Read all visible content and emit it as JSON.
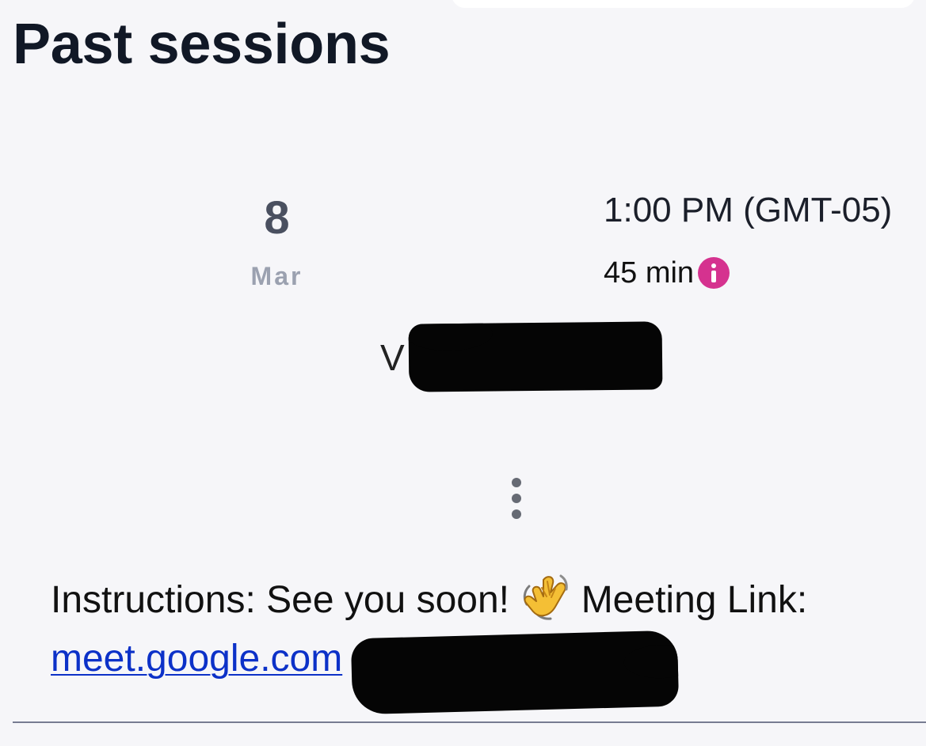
{
  "header": {
    "title": "Past sessions"
  },
  "session": {
    "date_day": "8",
    "date_month": "Mar",
    "time": "1:00 PM (GMT-05)",
    "duration": "45 min",
    "info_icon": "info-icon",
    "info_icon_color": "#d5328f",
    "attendee_name_visible": "V",
    "menu_icon": "vertical-ellipsis-icon",
    "instructions_prefix": "Instructions: See you soon!",
    "wave_icon": "waving-hand-icon",
    "instructions_suffix": "Meeting Link:",
    "meeting_link_visible": "meet.google.com"
  },
  "colors": {
    "background": "#f6f6f9",
    "title": "#111826",
    "date_day": "#4a5060",
    "date_month": "#9ba1b0",
    "link": "#0c31c8",
    "redaction": "#050505",
    "divider": "#777c92"
  }
}
